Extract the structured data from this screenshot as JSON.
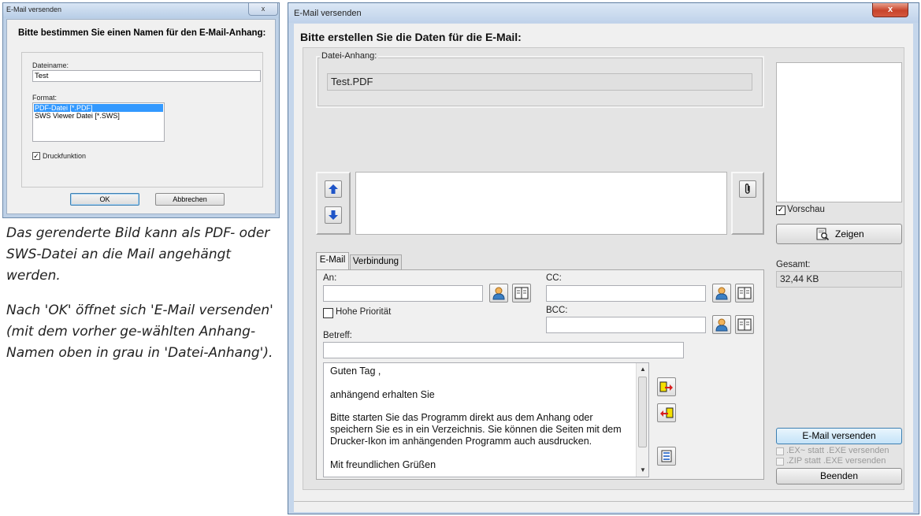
{
  "dialog_small": {
    "title": "E-Mail versenden",
    "close_glyph": "x",
    "heading": "Bitte bestimmen Sie einen Namen für den E-Mail-Anhang:",
    "filename_label": "Dateiname:",
    "filename_value": "Test",
    "format_label": "Format:",
    "format_options": [
      "PDF-Datei [*.PDF]",
      "SWS Viewer Datei [*.SWS]"
    ],
    "selected_format": "PDF-Datei [*.PDF]",
    "print_checkbox_label": "Druckfunktion",
    "print_checked": true,
    "ok_label": "OK",
    "cancel_label": "Abbrechen"
  },
  "caption": {
    "p1": "Das gerenderte Bild kann als PDF- oder SWS-Datei an die Mail angehängt werden.",
    "p2": "Nach 'OK' öffnet sich 'E-Mail versenden' (mit dem vorher ge-wählten Anhang-Namen oben in grau in 'Datei-Anhang')."
  },
  "window": {
    "title": "E-Mail versenden",
    "close_glyph": "x",
    "heading": "Bitte erstellen Sie die Daten für die E-Mail:",
    "attachment_group_label": "Datei-Anhang:",
    "attachment_value": "Test.PDF",
    "preview_checkbox_label": "Vorschau",
    "preview_checked": true,
    "show_button_label": "Zeigen",
    "total_label": "Gesamt:",
    "total_value": "32,44 KB",
    "send_button_label": "E-Mail versenden",
    "ex_option_label": ".EX~ statt .EXE versenden",
    "zip_option_label": ".ZIP statt .EXE versenden",
    "close_button_label": "Beenden",
    "tabs": [
      "E-Mail",
      "Verbindung"
    ],
    "to_label": "An:",
    "to_value": "",
    "cc_label": "CC:",
    "cc_value": "",
    "bcc_label": "BCC:",
    "bcc_value": "",
    "priority_label": "Hohe Priorität",
    "priority_checked": false,
    "subject_label": "Betreff:",
    "subject_value": "",
    "body_lines": [
      "Guten Tag ,",
      "anhängend erhalten Sie",
      "Bitte starten Sie das Programm direkt aus dem Anhang oder",
      "speichern Sie es in ein Verzeichnis. Sie können die Seiten mit dem",
      "Drucker-Ikon im anhängenden Programm auch ausdrucken.",
      "Mit freundlichen Grüßen"
    ]
  },
  "colors": {
    "selection": "#3399ff",
    "arrow_blue": "#1f55c8",
    "window_frame": "#c5d6eb",
    "close_red": "#c8442b"
  },
  "icons": [
    "arrow-up-icon",
    "arrow-down-icon",
    "paperclip-icon",
    "contact-person-icon",
    "address-book-icon",
    "insert-text-icon",
    "remove-text-icon",
    "template-icon",
    "magnifier-page-icon"
  ]
}
